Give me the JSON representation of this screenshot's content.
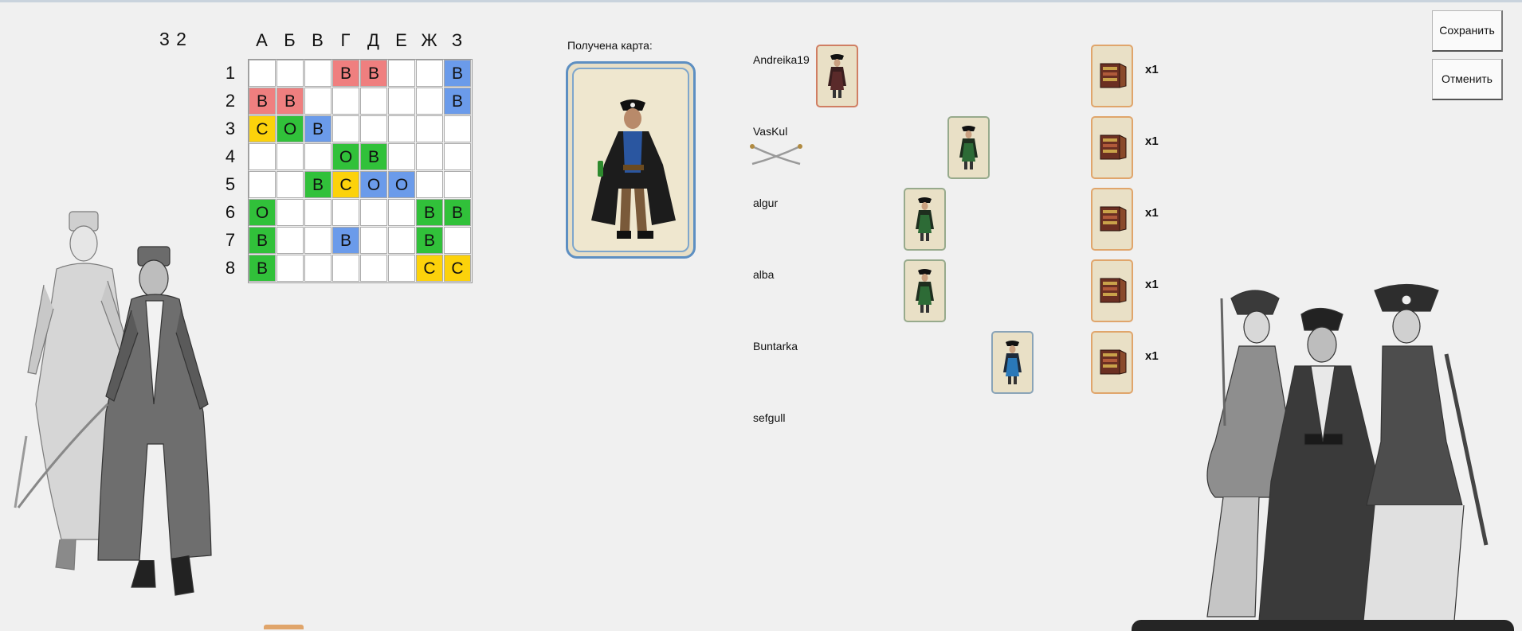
{
  "turn_counter": "3 2",
  "board": {
    "columns": [
      "А",
      "Б",
      "В",
      "Г",
      "Д",
      "Е",
      "Ж",
      "З"
    ],
    "rows": [
      "1",
      "2",
      "3",
      "4",
      "5",
      "6",
      "7",
      "8"
    ],
    "cells": [
      {
        "r": 0,
        "c": 3,
        "letter": "В",
        "color": "red"
      },
      {
        "r": 0,
        "c": 4,
        "letter": "В",
        "color": "red"
      },
      {
        "r": 0,
        "c": 7,
        "letter": "В",
        "color": "blue"
      },
      {
        "r": 1,
        "c": 0,
        "letter": "В",
        "color": "red"
      },
      {
        "r": 1,
        "c": 1,
        "letter": "В",
        "color": "red"
      },
      {
        "r": 1,
        "c": 7,
        "letter": "В",
        "color": "blue"
      },
      {
        "r": 2,
        "c": 0,
        "letter": "С",
        "color": "yellow"
      },
      {
        "r": 2,
        "c": 1,
        "letter": "О",
        "color": "green"
      },
      {
        "r": 2,
        "c": 2,
        "letter": "В",
        "color": "blue"
      },
      {
        "r": 3,
        "c": 3,
        "letter": "О",
        "color": "green"
      },
      {
        "r": 3,
        "c": 4,
        "letter": "В",
        "color": "green"
      },
      {
        "r": 4,
        "c": 2,
        "letter": "В",
        "color": "green"
      },
      {
        "r": 4,
        "c": 3,
        "letter": "С",
        "color": "yellow"
      },
      {
        "r": 4,
        "c": 4,
        "letter": "О",
        "color": "blue"
      },
      {
        "r": 4,
        "c": 5,
        "letter": "О",
        "color": "blue"
      },
      {
        "r": 5,
        "c": 0,
        "letter": "О",
        "color": "green"
      },
      {
        "r": 5,
        "c": 6,
        "letter": "В",
        "color": "green"
      },
      {
        "r": 5,
        "c": 7,
        "letter": "В",
        "color": "green"
      },
      {
        "r": 6,
        "c": 0,
        "letter": "В",
        "color": "green"
      },
      {
        "r": 6,
        "c": 3,
        "letter": "В",
        "color": "blue"
      },
      {
        "r": 6,
        "c": 6,
        "letter": "В",
        "color": "green"
      },
      {
        "r": 7,
        "c": 0,
        "letter": "В",
        "color": "green"
      },
      {
        "r": 7,
        "c": 6,
        "letter": "С",
        "color": "yellow"
      },
      {
        "r": 7,
        "c": 7,
        "letter": "С",
        "color": "yellow"
      }
    ]
  },
  "received": {
    "label": "Получена карта:",
    "card": "pirate-captain-card"
  },
  "players": [
    {
      "name": "Andreika19",
      "card": "captain-card",
      "card_border": "red",
      "chest_count": "x1"
    },
    {
      "name": "VasKul",
      "card": "pirate-woman-card",
      "card_border": "green",
      "chest_count": "x1",
      "active_icon": "crossed-swords-icon"
    },
    {
      "name": "algur",
      "card": "pirate-woman-card",
      "card_border": "green",
      "chest_count": "x1"
    },
    {
      "name": "alba",
      "card": "pirate-woman-card",
      "card_border": "green",
      "chest_count": "x1"
    },
    {
      "name": "Buntarka",
      "card": "pirate-woman-blue-card",
      "card_border": "blue",
      "chest_count": "x1"
    },
    {
      "name": "sefgull"
    }
  ],
  "buttons": {
    "save": "Сохранить",
    "cancel": "Отменить"
  },
  "colors": {
    "background": "#f0f0f0",
    "red": "#ef7f7f",
    "blue": "#6b9bea",
    "green": "#31c13a",
    "yellow": "#fcd20b",
    "card_blue_frame": "#5d8fc2",
    "chest_card_frame": "#e0a56b"
  },
  "illustrations": [
    "officers-illustration",
    "pirate-women-illustration"
  ]
}
